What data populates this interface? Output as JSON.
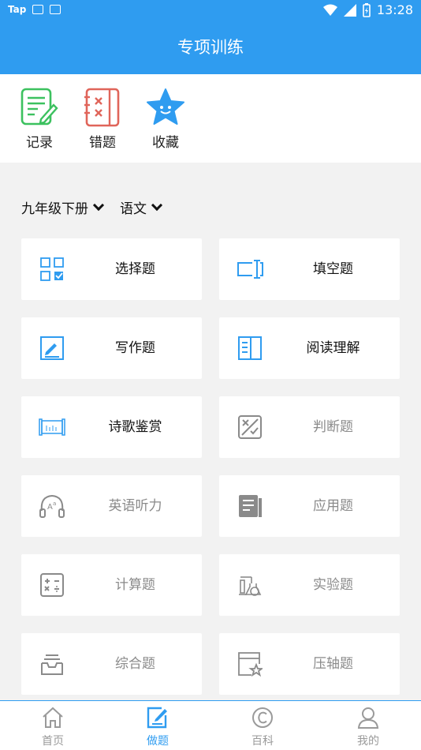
{
  "colors": {
    "primary": "#2f9cf0",
    "green": "#3cc15f",
    "red": "#e0655a",
    "gray": "#8a8a8a"
  },
  "status_bar": {
    "app_label": "Tap",
    "time": "13:28"
  },
  "header": {
    "title": "专项训练"
  },
  "quick_actions": [
    {
      "label": "记录",
      "icon": "record-icon"
    },
    {
      "label": "错题",
      "icon": "wrong-questions-icon"
    },
    {
      "label": "收藏",
      "icon": "star-icon"
    }
  ],
  "filters": {
    "grade": "九年级下册",
    "subject": "语文"
  },
  "cards": [
    {
      "label": "选择题",
      "icon": "multiple-choice-icon",
      "enabled": true
    },
    {
      "label": "填空题",
      "icon": "fill-blank-icon",
      "enabled": true
    },
    {
      "label": "写作题",
      "icon": "writing-icon",
      "enabled": true
    },
    {
      "label": "阅读理解",
      "icon": "reading-icon",
      "enabled": true
    },
    {
      "label": "诗歌鉴赏",
      "icon": "poetry-scroll-icon",
      "enabled": true
    },
    {
      "label": "判断题",
      "icon": "true-false-icon",
      "enabled": false
    },
    {
      "label": "英语听力",
      "icon": "listening-icon",
      "enabled": false
    },
    {
      "label": "应用题",
      "icon": "application-icon",
      "enabled": false
    },
    {
      "label": "计算题",
      "icon": "calculator-icon",
      "enabled": false
    },
    {
      "label": "实验题",
      "icon": "lab-icon",
      "enabled": false
    },
    {
      "label": "综合题",
      "icon": "inbox-icon",
      "enabled": false
    },
    {
      "label": "压轴题",
      "icon": "star-window-icon",
      "enabled": false
    }
  ],
  "tabs": [
    {
      "label": "首页",
      "icon": "home-icon",
      "active": false
    },
    {
      "label": "做题",
      "icon": "edit-icon",
      "active": true
    },
    {
      "label": "百科",
      "icon": "copyright-icon",
      "active": false
    },
    {
      "label": "我的",
      "icon": "user-icon",
      "active": false
    }
  ]
}
